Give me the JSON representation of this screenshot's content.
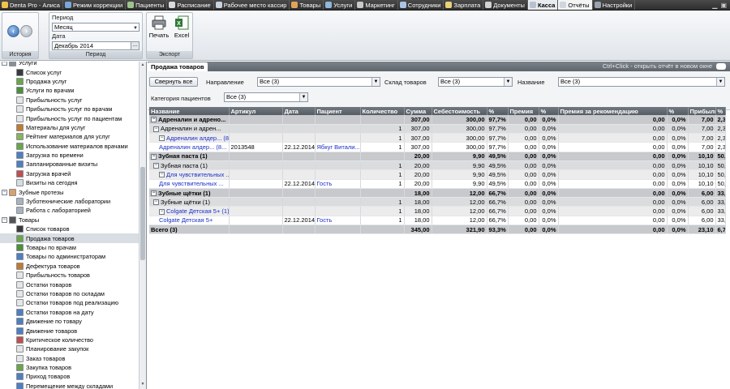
{
  "topbar": {
    "tabs": [
      {
        "label": "Denta Pro - Алиса",
        "icon": "app-logo-icon",
        "color": "#f2c14e",
        "state": "app"
      },
      {
        "label": "Режим коррекции",
        "icon": "edit-icon",
        "color": "#7aa7d9",
        "state": ""
      },
      {
        "label": "Пациенты",
        "icon": "patients-icon",
        "color": "#9cc58a",
        "state": ""
      },
      {
        "label": "Расписание",
        "icon": "calendar-icon",
        "color": "#d8dadd",
        "state": ""
      },
      {
        "label": "Рабочее место кассир",
        "icon": "cashier-icon",
        "color": "#c9d3de",
        "state": ""
      },
      {
        "label": "Товары",
        "icon": "goods-icon",
        "color": "#e0a35a",
        "state": ""
      },
      {
        "label": "Услуги",
        "icon": "services-icon",
        "color": "#8fb7de",
        "state": ""
      },
      {
        "label": "Маркетинг",
        "icon": "marketing-icon",
        "color": "#c9c9c9",
        "state": ""
      },
      {
        "label": "Сотрудники",
        "icon": "staff-icon",
        "color": "#a8c4e6",
        "state": ""
      },
      {
        "label": "Зарплата",
        "icon": "salary-icon",
        "color": "#e8d27a",
        "state": ""
      },
      {
        "label": "Документы",
        "icon": "documents-icon",
        "color": "#d2d2d2",
        "state": ""
      },
      {
        "label": "Касса",
        "icon": "cashbox-icon",
        "color": "#b7c2cf",
        "state": "active"
      },
      {
        "label": "Отчёты",
        "icon": "reports-icon",
        "color": "#cfd6de",
        "state": "sel"
      },
      {
        "label": "Настройки",
        "icon": "settings-icon",
        "color": "#9aa3ad",
        "state": ""
      }
    ]
  },
  "ribbon": {
    "period_label": "Период",
    "period_value": "Месяц",
    "date_label": "Дата",
    "date_value": "Декабрь 2014",
    "history_caption": "История",
    "period_caption": "Период",
    "print_label": "Печать",
    "excel_label": "Excel",
    "export_caption": "Экспорт"
  },
  "sidebar": {
    "items": [
      {
        "label": "Услуги",
        "level": 0,
        "expander": "−",
        "icon": "services-folder-icon",
        "color": "#8a8f96"
      },
      {
        "label": "Список услуг",
        "level": 1,
        "icon": "tooth-list-icon",
        "color": "#3a3a3a"
      },
      {
        "label": "Продажа услуг",
        "level": 1,
        "icon": "services-sale-icon",
        "color": "#6aa54a"
      },
      {
        "label": "Услуги по врачам",
        "level": 1,
        "icon": "doctor-services-icon",
        "color": "#4e8f3a"
      },
      {
        "label": "Прибыльность услуг",
        "level": 1,
        "icon": "profit-icon",
        "color": "#e6e6e6"
      },
      {
        "label": "Прибыльность услуг по врачам",
        "level": 1,
        "icon": "profit-doctor-icon",
        "color": "#e6e6e6"
      },
      {
        "label": "Прибыльность услуг по пациентам",
        "level": 1,
        "icon": "profit-patient-icon",
        "color": "#e6e6e6"
      },
      {
        "label": "Материалы для услуг",
        "level": 1,
        "icon": "materials-icon",
        "color": "#c27a2f"
      },
      {
        "label": "Рейтинг материалов для услуг",
        "level": 1,
        "icon": "rating-icon",
        "color": "#8ab35a"
      },
      {
        "label": "Использование материалов врачами",
        "level": 1,
        "icon": "usage-icon",
        "color": "#6aa54a"
      },
      {
        "label": "Загрузка по времени",
        "level": 1,
        "icon": "time-load-icon",
        "color": "#4f7fc0"
      },
      {
        "label": "Запланированные визиты",
        "level": 1,
        "icon": "planned-visits-icon",
        "color": "#4f7fc0"
      },
      {
        "label": "Загрузка врачей",
        "level": 1,
        "icon": "doctor-load-icon",
        "color": "#c04f4f"
      },
      {
        "label": "Визиты на сегодня",
        "level": 1,
        "icon": "today-visits-icon",
        "color": "#d8dde3"
      },
      {
        "label": "Зубные протезы",
        "level": 0,
        "expander": "−",
        "icon": "dentures-icon",
        "color": "#d9a06a"
      },
      {
        "label": "Зуботехнические лаборатории",
        "level": 1,
        "icon": "lab-icon",
        "color": "#aab2bb"
      },
      {
        "label": "Работа с лабораторией",
        "level": 1,
        "icon": "lab-work-icon",
        "color": "#aab2bb"
      },
      {
        "label": "Товары",
        "level": 0,
        "expander": "−",
        "icon": "goods-folder-icon",
        "color": "#555555"
      },
      {
        "label": "Список товаров",
        "level": 1,
        "icon": "goods-list-icon",
        "color": "#3a3a3a"
      },
      {
        "label": "Продажа товаров",
        "level": 1,
        "icon": "goods-sale-icon",
        "color": "#6aa54a",
        "selected": true
      },
      {
        "label": "Товары по врачам",
        "level": 1,
        "icon": "goods-doctor-icon",
        "color": "#4e8f3a"
      },
      {
        "label": "Товары по администраторам",
        "level": 1,
        "icon": "goods-admin-icon",
        "color": "#4f7fc0"
      },
      {
        "label": "Дефектура товаров",
        "level": 1,
        "icon": "defect-icon",
        "color": "#c27a2f"
      },
      {
        "label": "Прибыльность товаров",
        "level": 1,
        "icon": "goods-profit-icon",
        "color": "#e6e6e6"
      },
      {
        "label": "Остатки товаров",
        "level": 1,
        "icon": "stock-icon",
        "color": "#e6e6e6"
      },
      {
        "label": "Остатки товаров по складам",
        "level": 1,
        "icon": "stock-warehouse-icon",
        "color": "#e6e6e6"
      },
      {
        "label": "Остатки товаров под реализацию",
        "level": 1,
        "icon": "stock-consign-icon",
        "color": "#e6e6e6"
      },
      {
        "label": "Остатки товаров на дату",
        "level": 1,
        "icon": "stock-date-icon",
        "color": "#4f7fc0"
      },
      {
        "label": "Движение по товару",
        "level": 1,
        "icon": "movement-item-icon",
        "color": "#4f7fc0"
      },
      {
        "label": "Движение товаров",
        "level": 1,
        "icon": "movement-icon",
        "color": "#4f7fc0"
      },
      {
        "label": "Критическое количество",
        "level": 1,
        "icon": "critical-icon",
        "color": "#c04f4f"
      },
      {
        "label": "Планирование закупок",
        "level": 1,
        "icon": "planning-icon",
        "color": "#e6e6e6"
      },
      {
        "label": "Заказ товаров",
        "level": 1,
        "icon": "order-icon",
        "color": "#e6e6e6"
      },
      {
        "label": "Закупка товаров",
        "level": 1,
        "icon": "purchase-icon",
        "color": "#6aa54a"
      },
      {
        "label": "Приход товаров",
        "level": 1,
        "icon": "receipt-icon",
        "color": "#4f7fc0"
      },
      {
        "label": "Перемещение между складами",
        "level": 1,
        "icon": "transfer-icon",
        "color": "#4f7fc0"
      }
    ]
  },
  "report": {
    "tab_label": "Продажа товаров",
    "hint": "Ctrl+Click - открыть отчёт в новом окне",
    "filters": {
      "collapse_button": "Свернуть все",
      "direction_label": "Направление",
      "direction_value": "Все (3)",
      "warehouse_label": "Склад товаров",
      "warehouse_value": "Все (3)",
      "name_label": "Название",
      "name_value": "Все (3)",
      "category_label": "Категория пациентов",
      "category_value": "Все (3)"
    },
    "columns": [
      "Название",
      "Артикул",
      "Дата",
      "Пациент",
      "Количество",
      "Сумма",
      "Себестоимость",
      "%",
      "Премия",
      "%",
      "Премия за рекомендацию",
      "%",
      "Прибыль",
      "%"
    ],
    "rows": [
      {
        "type": "g1",
        "exp": "−",
        "cells": [
          "Адреналин и адрено...",
          "",
          "",
          "",
          "",
          "307,00",
          "300,00",
          "97,7%",
          "0,00",
          "0,0%",
          "0,00",
          "0,0%",
          "7,00",
          "2,3%"
        ]
      },
      {
        "type": "g2",
        "exp": "−",
        "cells": [
          "Адреналин и адрен...",
          "",
          "",
          "",
          "1",
          "307,00",
          "300,00",
          "97,7%",
          "0,00",
          "0,0%",
          "0,00",
          "0,0%",
          "7,00",
          "2,3%"
        ]
      },
      {
        "type": "g3",
        "exp": "−",
        "link": true,
        "cells": [
          "Адреналин алдер... (8...",
          "",
          "",
          "",
          "1",
          "307,00",
          "300,00",
          "97,7%",
          "0,00",
          "0,0%",
          "0,00",
          "0,0%",
          "7,00",
          "2,3%"
        ]
      },
      {
        "type": "d",
        "link": true,
        "cells": [
          "Адреналин алдер... (8...",
          "2013548",
          "22.12.2014",
          "Ябкуг Витали...",
          "1",
          "307,00",
          "300,00",
          "97,7%",
          "0,00",
          "0,0%",
          "0,00",
          "0,0%",
          "7,00",
          "2,3%"
        ]
      },
      {
        "type": "g1",
        "exp": "−",
        "cells": [
          "Зубная паста (1)",
          "",
          "",
          "",
          "",
          "20,00",
          "9,90",
          "49,5%",
          "0,00",
          "0,0%",
          "0,00",
          "0,0%",
          "10,10",
          "50,5%"
        ]
      },
      {
        "type": "g2",
        "exp": "−",
        "cells": [
          "Зубная паста (1)",
          "",
          "",
          "",
          "1",
          "20,00",
          "9,90",
          "49,5%",
          "0,00",
          "0,0%",
          "0,00",
          "0,0%",
          "10,10",
          "50,5%"
        ]
      },
      {
        "type": "g3",
        "exp": "−",
        "link": true,
        "cells": [
          "Для чувствительных ...",
          "",
          "",
          "",
          "1",
          "20,00",
          "9,90",
          "49,5%",
          "0,00",
          "0,0%",
          "0,00",
          "0,0%",
          "10,10",
          "50,5%"
        ]
      },
      {
        "type": "d",
        "link": true,
        "cells": [
          "Для чувствительных ...",
          "",
          "22.12.2014",
          "Гость",
          "1",
          "20,00",
          "9,90",
          "49,5%",
          "0,00",
          "0,0%",
          "0,00",
          "0,0%",
          "10,10",
          "50,5%"
        ]
      },
      {
        "type": "g1",
        "exp": "−",
        "cells": [
          "Зубные щётки (1)",
          "",
          "",
          "",
          "",
          "18,00",
          "12,00",
          "66,7%",
          "0,00",
          "0,0%",
          "0,00",
          "0,0%",
          "6,00",
          "33,3%"
        ]
      },
      {
        "type": "g2",
        "exp": "−",
        "cells": [
          "Зубные щётки (1)",
          "",
          "",
          "",
          "1",
          "18,00",
          "12,00",
          "66,7%",
          "0,00",
          "0,0%",
          "0,00",
          "0,0%",
          "6,00",
          "33,3%"
        ]
      },
      {
        "type": "g3",
        "exp": "−",
        "link": true,
        "cells": [
          "Colgate Детская 5+ (1)",
          "",
          "",
          "",
          "1",
          "18,00",
          "12,00",
          "66,7%",
          "0,00",
          "0,0%",
          "0,00",
          "0,0%",
          "6,00",
          "33,3%"
        ]
      },
      {
        "type": "d",
        "link": true,
        "cells": [
          "Colgate Детская 5+",
          "",
          "22.12.2014",
          "Гость",
          "1",
          "18,00",
          "12,00",
          "66,7%",
          "0,00",
          "0,0%",
          "0,00",
          "0,0%",
          "6,00",
          "33,3%"
        ]
      },
      {
        "type": "tot",
        "cells": [
          "Всего (3)",
          "",
          "",
          "",
          "",
          "345,00",
          "321,90",
          "93,3%",
          "0,00",
          "0,0%",
          "0,00",
          "0,0%",
          "23,10",
          "6,7%"
        ]
      }
    ]
  }
}
